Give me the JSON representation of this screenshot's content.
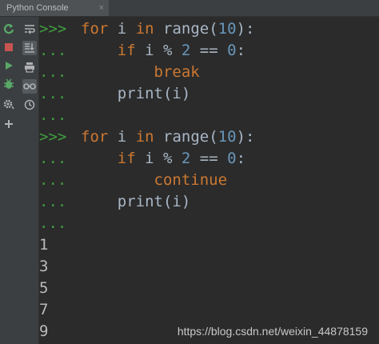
{
  "tab": {
    "title": "Python Console",
    "close": "×"
  },
  "toolbar": {
    "left_icons": [
      "rerun-icon",
      "stop-icon",
      "run-icon",
      "debug-icon",
      "settings-icon",
      "add-icon"
    ],
    "right_icons": [
      "soft-wrap-icon",
      "scroll-to-end-icon",
      "print-icon",
      "show-variables-icon",
      "history-icon"
    ]
  },
  "prompts": {
    "main": ">>>",
    "cont": "..."
  },
  "code": {
    "block1": {
      "for": "for",
      "i": "i",
      "in": "in",
      "range_open": "range(",
      "n": "10",
      "range_close": "):",
      "if": "if",
      "mod": "i %",
      "two": "2",
      "eq": "==",
      "zero": "0",
      "colon": ":",
      "stmt": "break",
      "print": "print(i)"
    },
    "block2": {
      "for": "for",
      "i": "i",
      "in": "in",
      "range_open": "range(",
      "n": "10",
      "range_close": "):",
      "if": "if",
      "mod": "i %",
      "two": "2",
      "eq": "==",
      "zero": "0",
      "colon": ":",
      "stmt": "continue",
      "print": "print(i)"
    }
  },
  "output": [
    "1",
    "3",
    "5",
    "7",
    "9"
  ],
  "watermark": "https://blog.csdn.net/weixin_44878159"
}
